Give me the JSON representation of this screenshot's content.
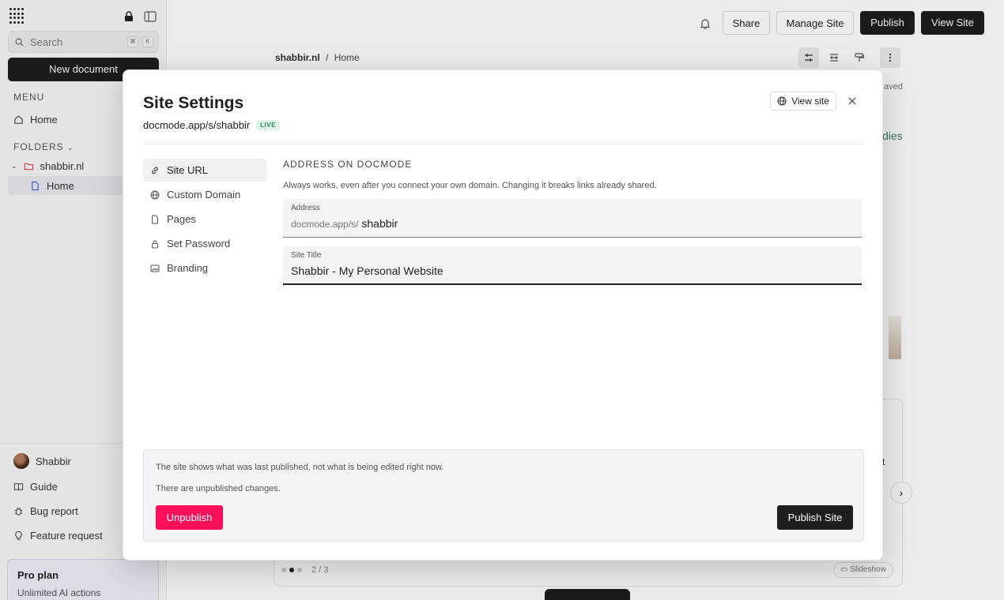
{
  "sidebar": {
    "search_label": "Search",
    "search_keys": [
      "⌘",
      "K"
    ],
    "new_document": "New document",
    "menu_label": "MENU",
    "home": "Home",
    "folders_label": "FOLDERS",
    "folder_name": "shabbir.nl",
    "folder_page": "Home",
    "user_name": "Shabbir",
    "guide": "Guide",
    "bug_report": "Bug report",
    "feature_request": "Feature request",
    "pro_plan_title": "Pro plan",
    "pro_plan_sub": "Unlimited AI actions"
  },
  "topbar": {
    "share": "Share",
    "manage_site": "Manage Site",
    "publish": "Publish",
    "view_site": "View Site"
  },
  "breadcrumb": {
    "root": "shabbir.nl",
    "sep": "/",
    "page": "Home"
  },
  "background": {
    "saved_text": "aved",
    "link_text": "dies",
    "card_text": "t",
    "slide_counter": "2 / 3",
    "slideshow": "Slideshow"
  },
  "modal": {
    "title": "Site Settings",
    "site_url": "docmode.app/s/shabbir",
    "live_badge": "LIVE",
    "view_site": "View site",
    "nav": [
      {
        "label": "Site URL"
      },
      {
        "label": "Custom Domain"
      },
      {
        "label": "Pages"
      },
      {
        "label": "Set Password"
      },
      {
        "label": "Branding"
      }
    ],
    "section_heading": "ADDRESS ON DOCMODE",
    "section_desc": "Always works, even after you connect your own domain. Changing it breaks links already shared.",
    "address_label": "Address",
    "address_prefix": "docmode.app/s/",
    "address_value": "shabbir",
    "title_label": "Site Title",
    "title_value": "Shabbir - My Personal Website",
    "publish_info": "The site shows what was last published, not what is being edited right now.",
    "unpublished_note": "There are unpublished changes.",
    "unpublish": "Unpublish",
    "publish_site": "Publish Site"
  },
  "colors": {
    "accent_dark": "#1e1e1e",
    "danger": "#ff0f5a",
    "live_green": "#2e8b57"
  }
}
